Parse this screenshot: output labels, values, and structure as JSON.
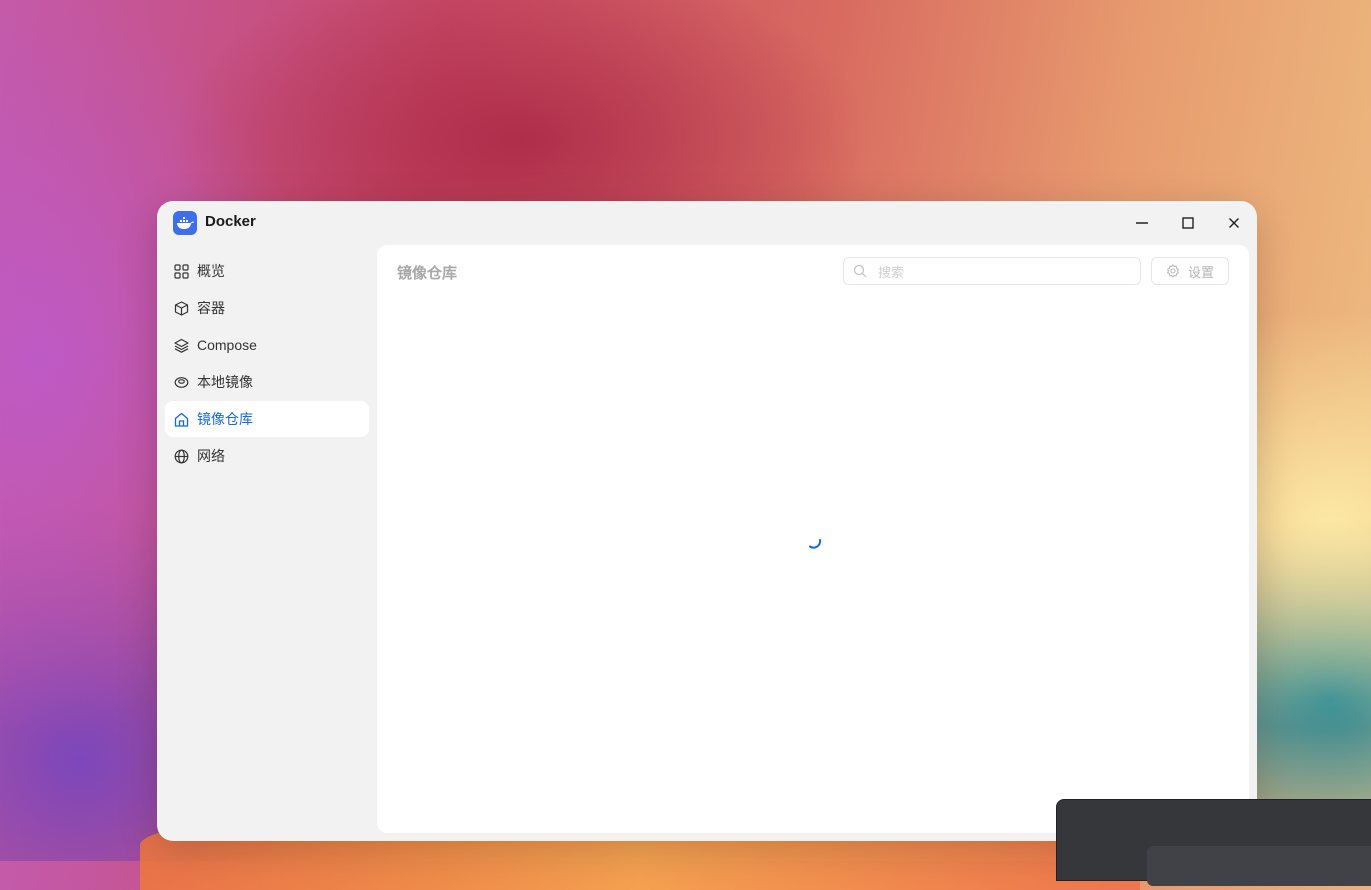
{
  "window": {
    "app_title": "Docker",
    "controls": [
      "minimize",
      "maximize",
      "close"
    ]
  },
  "sidebar": {
    "items": [
      {
        "label": "概览",
        "icon": "grid-icon",
        "active": false
      },
      {
        "label": "容器",
        "icon": "cube-icon",
        "active": false
      },
      {
        "label": "Compose",
        "icon": "layers-icon",
        "active": false
      },
      {
        "label": "本地镜像",
        "icon": "disk-icon",
        "active": false
      },
      {
        "label": "镜像仓库",
        "icon": "home-icon",
        "active": true
      },
      {
        "label": "网络",
        "icon": "globe-icon",
        "active": false
      }
    ]
  },
  "main": {
    "title": "镜像仓库",
    "search_placeholder": "搜索",
    "search_value": "",
    "settings_label": "设置",
    "loading": true
  },
  "colors": {
    "accent": "#1668dc",
    "window_bg": "#f2f2f2",
    "content_bg": "#ffffff",
    "logo_bg": "#3f6fe8"
  }
}
